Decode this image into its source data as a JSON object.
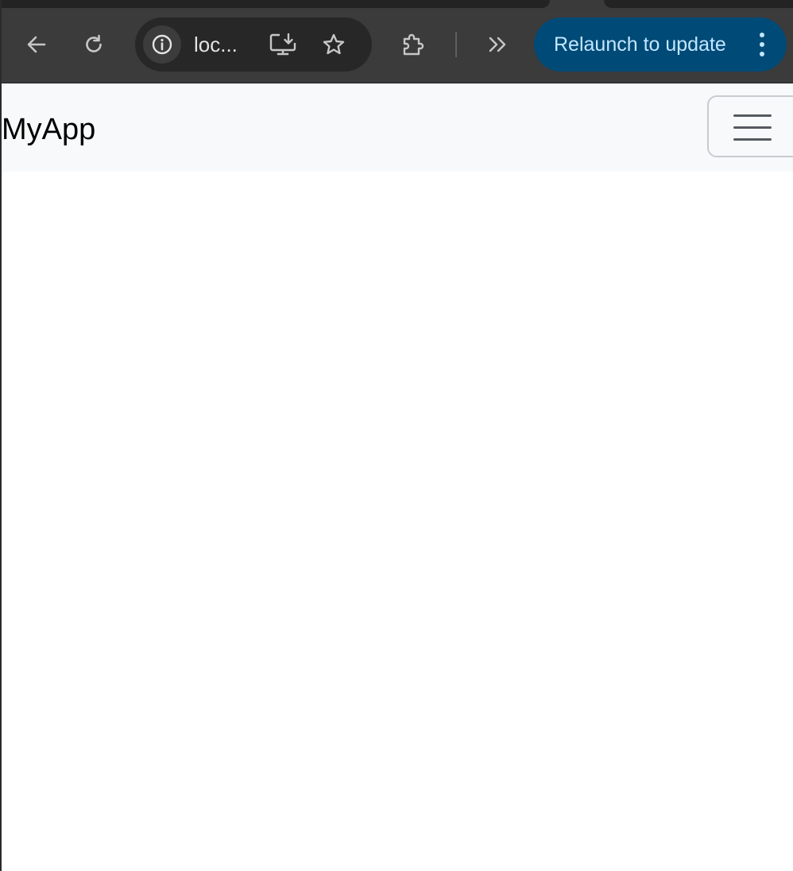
{
  "browser": {
    "address_bar": {
      "url_display": "loc..."
    },
    "relaunch_button": {
      "label": "Relaunch to update"
    },
    "icons": {
      "back": "back-arrow-icon",
      "reload": "reload-icon",
      "site_info": "info-icon",
      "install": "install-app-icon",
      "bookmark": "star-icon",
      "extensions": "puzzle-piece-icon",
      "overflow": "chevron-double-right-icon",
      "menu": "vertical-dots-icon"
    },
    "colors": {
      "toolbar_bg": "#3b3b3b",
      "relaunch_bg": "#004a77",
      "relaunch_text": "#c2e7ff"
    }
  },
  "app": {
    "navbar": {
      "brand": "MyApp",
      "toggler_icon": "hamburger-menu-icon"
    },
    "colors": {
      "navbar_bg": "#f8f9fa"
    }
  }
}
